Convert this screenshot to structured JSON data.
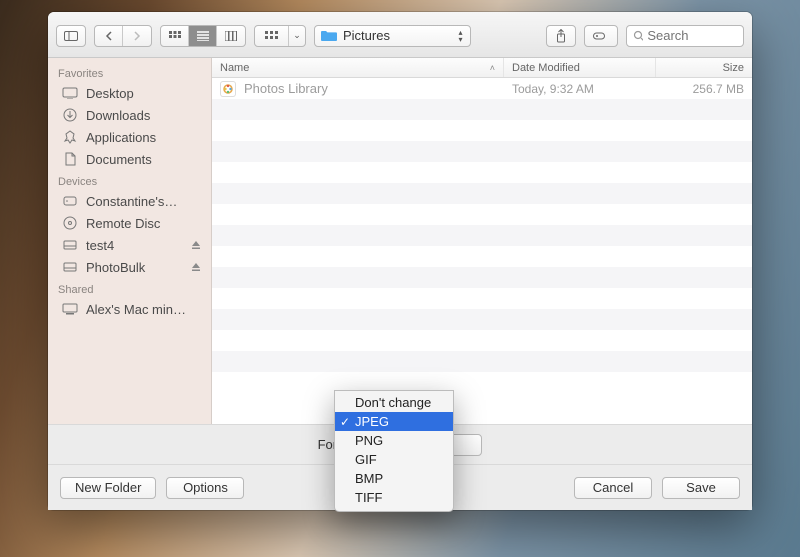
{
  "toolbar": {
    "path_label": "Pictures",
    "search_placeholder": "Search"
  },
  "sidebar": {
    "sections": [
      {
        "title": "Favorites",
        "items": [
          {
            "icon": "desktop",
            "label": "Desktop"
          },
          {
            "icon": "downloads",
            "label": "Downloads"
          },
          {
            "icon": "applications",
            "label": "Applications"
          },
          {
            "icon": "documents",
            "label": "Documents"
          }
        ]
      },
      {
        "title": "Devices",
        "items": [
          {
            "icon": "disk",
            "label": "Constantine's…"
          },
          {
            "icon": "optical",
            "label": "Remote Disc"
          },
          {
            "icon": "ext",
            "label": "test4",
            "eject": true
          },
          {
            "icon": "ext",
            "label": "PhotoBulk",
            "eject": true
          }
        ]
      },
      {
        "title": "Shared",
        "items": [
          {
            "icon": "computer",
            "label": "Alex's Mac min…"
          }
        ]
      }
    ]
  },
  "columns": {
    "name": "Name",
    "date": "Date Modified",
    "size": "Size"
  },
  "files": [
    {
      "name": "Photos Library",
      "date": "Today, 9:32 AM",
      "size": "256.7 MB"
    }
  ],
  "format": {
    "label": "Format:",
    "selected": "JPEG",
    "options": [
      "Don't change",
      "JPEG",
      "PNG",
      "GIF",
      "BMP",
      "TIFF"
    ]
  },
  "buttons": {
    "new_folder": "New Folder",
    "options": "Options",
    "cancel": "Cancel",
    "save": "Save"
  }
}
